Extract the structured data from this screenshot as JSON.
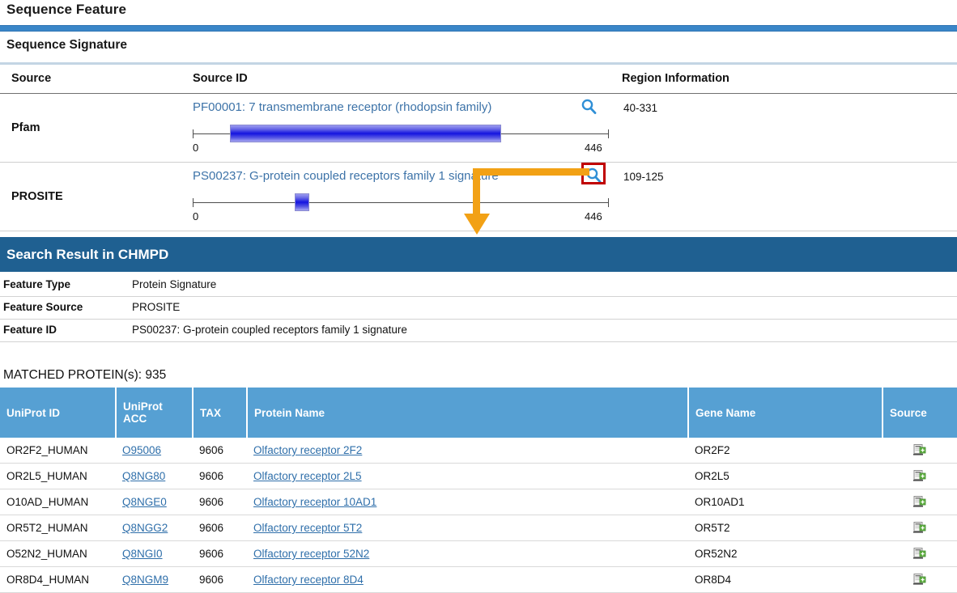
{
  "page": {
    "title": "Sequence Feature",
    "section_title": "Sequence Signature"
  },
  "signature_table": {
    "headers": {
      "source": "Source",
      "source_id": "Source ID",
      "region": "Region Information"
    },
    "rows": [
      {
        "source": "Pfam",
        "source_id": "PF00001: 7 transmembrane receptor (rhodopsin family)",
        "region": "40-331",
        "magnifier_icon": "search-icon",
        "axis_start": "0",
        "axis_end": "446",
        "domain_start": 40,
        "domain_end": 331,
        "length": 446
      },
      {
        "source": "PROSITE",
        "source_id": "PS00237: G-protein coupled receptors family 1 signature",
        "region": "109-125",
        "magnifier_icon": "search-icon",
        "axis_start": "0",
        "axis_end": "446",
        "domain_start": 109,
        "domain_end": 125,
        "length": 446
      }
    ]
  },
  "chmpd": {
    "header": "Search Result in CHMPD",
    "details": [
      {
        "label": "Feature Type",
        "value": "Protein Signature"
      },
      {
        "label": "Feature Source",
        "value": "PROSITE"
      },
      {
        "label": "Feature ID",
        "value": "PS00237: G-protein coupled receptors family 1 signature"
      }
    ]
  },
  "matched": {
    "title": "MATCHED PROTEIN(s): 935",
    "columns": [
      "UniProt ID",
      "UniProt ACC",
      "TAX",
      "Protein Name",
      "Gene Name",
      "Source"
    ],
    "rows": [
      {
        "uniprot_id": "OR2F2_HUMAN",
        "acc": "O95006",
        "tax": "9606",
        "protein_name": "Olfactory receptor 2F2",
        "gene": "OR2F2",
        "source_icon": "document-add-icon"
      },
      {
        "uniprot_id": "OR2L5_HUMAN",
        "acc": "Q8NG80",
        "tax": "9606",
        "protein_name": "Olfactory receptor 2L5",
        "gene": "OR2L5",
        "source_icon": "document-add-icon"
      },
      {
        "uniprot_id": "O10AD_HUMAN",
        "acc": "Q8NGE0",
        "tax": "9606",
        "protein_name": "Olfactory receptor 10AD1",
        "gene": "OR10AD1",
        "source_icon": "document-add-icon"
      },
      {
        "uniprot_id": "OR5T2_HUMAN",
        "acc": "Q8NGG2",
        "tax": "9606",
        "protein_name": "Olfactory receptor 5T2",
        "gene": "OR5T2",
        "source_icon": "document-add-icon"
      },
      {
        "uniprot_id": "O52N2_HUMAN",
        "acc": "Q8NGI0",
        "tax": "9606",
        "protein_name": "Olfactory receptor 52N2",
        "gene": "OR52N2",
        "source_icon": "document-add-icon"
      },
      {
        "uniprot_id": "OR8D4_HUMAN",
        "acc": "Q8NGM9",
        "tax": "9606",
        "protein_name": "Olfactory receptor 8D4",
        "gene": "OR8D4",
        "source_icon": "document-add-icon"
      }
    ]
  },
  "annotation": {
    "highlight_target": "prosite-magnifier",
    "highlight_color": "#c00000",
    "arrow_color": "#f2a115"
  },
  "colors": {
    "top_rule": "#3a86c8",
    "chmpd_header": "#1f6091",
    "table_header": "#56a0d3",
    "link": "#2f6faa",
    "domain_bar": "#1414e0"
  }
}
